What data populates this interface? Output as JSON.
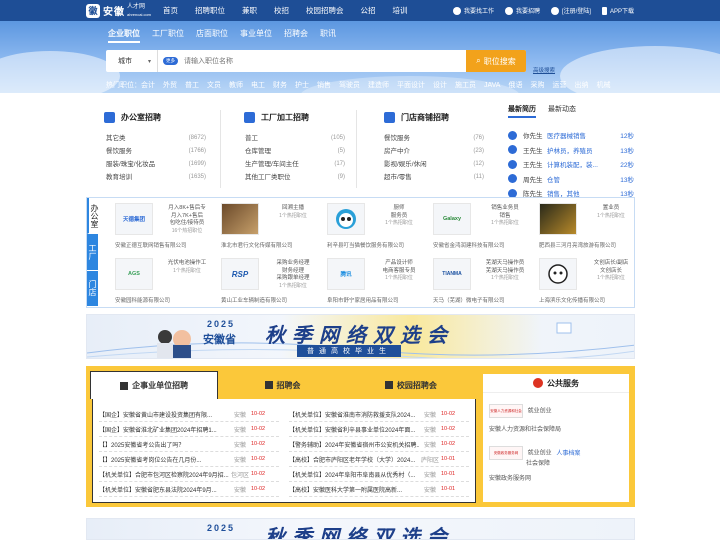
{
  "header": {
    "logo_cn": "安徽",
    "logo_small": "人才网",
    "logo_sub": "ahrencai.com",
    "nav": [
      "首页",
      "招聘职位",
      "兼职",
      "校招",
      "校园招聘会",
      "公招",
      "培训"
    ],
    "right": [
      "我要找工作",
      "我要招聘",
      "[注册/登陆]",
      "APP下载"
    ]
  },
  "search": {
    "tabs": [
      "企业职位",
      "工厂职位",
      "店面职位",
      "事业单位",
      "招聘会",
      "职讯"
    ],
    "city": "城市",
    "more_badge": "更多",
    "placeholder": "请输入职位名称",
    "button": "职位搜索",
    "advanced": "高级搜索",
    "hot_label": "热门职位：",
    "hot": [
      "会计",
      "外贸",
      "普工",
      "文员",
      "教师",
      "电工",
      "财务",
      "护士",
      "销售",
      "驾驶员",
      "建造师",
      "平面设计",
      "设计",
      "施工员",
      "JAVA",
      "俄语",
      "采购",
      "运营",
      "出纳",
      "机械"
    ]
  },
  "categories": [
    {
      "title": "办公室招聘",
      "items": [
        {
          "name": "其它类",
          "count": "(8672)"
        },
        {
          "name": "餐饮服务",
          "count": "(1766)"
        },
        {
          "name": "服装/珠宝/化妆品",
          "count": "(1699)"
        },
        {
          "name": "教育培训",
          "count": "(1635)"
        }
      ]
    },
    {
      "title": "工厂加工招聘",
      "items": [
        {
          "name": "普工",
          "count": "(105)"
        },
        {
          "name": "仓库管理",
          "count": "(5)"
        },
        {
          "name": "生产管理/车间主任",
          "count": "(17)"
        },
        {
          "name": "其他工厂类职位",
          "count": "(9)"
        }
      ]
    },
    {
      "title": "门店商铺招聘",
      "items": [
        {
          "name": "餐饮服务",
          "count": "(76)"
        },
        {
          "name": "房产中介",
          "count": "(23)"
        },
        {
          "name": "影视/娱乐/休闲",
          "count": "(12)"
        },
        {
          "name": "超市/零售",
          "count": "(11)"
        }
      ]
    }
  ],
  "latest": {
    "tabs": [
      "最新简历",
      "最新动态"
    ],
    "rows": [
      {
        "name": "你先生",
        "job": "医疗器械销售",
        "time": "12秒"
      },
      {
        "name": "王先生",
        "job": "护林员，养殖员",
        "time": "13秒"
      },
      {
        "name": "王先生",
        "job": "计算机装配，装...",
        "time": "22秒"
      },
      {
        "name": "周先生",
        "job": "仓管",
        "time": "13秒"
      },
      {
        "name": "陈先生",
        "job": "销售，其他",
        "time": "13秒"
      }
    ]
  },
  "companies": {
    "side_tabs": [
      "办公室",
      "工厂",
      "门店"
    ],
    "cards": [
      {
        "logo": "天德集团",
        "jobs": [
          "月入8K+售后专",
          "月入7K+售后",
          "包吃住/接待员"
        ],
        "more": "16个热招职位",
        "company": "安徽正德互联网销售有限公司"
      },
      {
        "logo": "",
        "jobs": [
          "回溯主播"
        ],
        "more": "1个热招职位",
        "company": "淮北市君行文化传媒有限公司"
      },
      {
        "logo": "",
        "jobs": [
          "厨师",
          "服务员"
        ],
        "more": "1个热招职位",
        "company": "利辛县叮当猫餐饮服务有限公司"
      },
      {
        "logo": "Galaxy",
        "jobs": [
          "销售业务员",
          "销售"
        ],
        "more": "1个热招职位",
        "company": "安徽省金鸿润建科技有限公司"
      },
      {
        "logo": "",
        "jobs": [
          "置业员"
        ],
        "more": "1个热招职位",
        "company": "肥西县三河月亮湾旅游有限公司"
      },
      {
        "logo": "AGS",
        "jobs": [
          "光伏电池操作工"
        ],
        "more": "1个热招职位",
        "company": "安徽园科能源有限公司"
      },
      {
        "logo": "RSP",
        "jobs": [
          "采购业务经理",
          "财务经理",
          "采购跟单经理"
        ],
        "more": "1个热招职位",
        "company": "黄山工业车辆制造有限公司"
      },
      {
        "logo": "腾讯",
        "jobs": [
          "产品设计师",
          "电商客服专员"
        ],
        "more": "1个热招职位",
        "company": "阜阳市舒宁家居用品有限公司"
      },
      {
        "logo": "TIANMA",
        "jobs": [
          "芜湖天马操作员",
          "芜湖天马操作员"
        ],
        "more": "1个热招职位",
        "company": "天马（芜湖）微电子有限公司"
      },
      {
        "logo": "",
        "jobs": [
          "文创店长/副店",
          "文创店长"
        ],
        "more": "1个热招职位",
        "company": "上海滨乐文化传播有限公司"
      }
    ]
  },
  "banner": {
    "year": "2025",
    "province": "安徽省",
    "title": "秋季网络双选会",
    "subtitle": "普通高校毕业生"
  },
  "joblist": {
    "tabs": [
      "企事业单位招聘",
      "招聘会",
      "校园招聘会"
    ],
    "left": [
      {
        "title": "【国企】安徽省黄山市建设投资集团有限...",
        "city": "安徽",
        "date": "10-02"
      },
      {
        "title": "【国企】安徽省淮北矿业集团2024年招聘1...",
        "city": "安徽",
        "date": "10-02"
      },
      {
        "title": "【】2025安徽省考公告出了吗？",
        "city": "安徽",
        "date": "10-02"
      },
      {
        "title": "【】2025安徽省考岗位公告在几月份...",
        "city": "安徽",
        "date": "10-02"
      },
      {
        "title": "【机关单位】合肥市包河区检察院2024年9月招...",
        "city": "包河区",
        "date": "10-02"
      },
      {
        "title": "【机关单位】安徽省肥东县法院2024年9月...",
        "city": "安徽",
        "date": "10-02"
      }
    ],
    "right": [
      {
        "title": "【机关单位】安徽省淮南市消防救援支队2024...",
        "city": "安徽",
        "date": "10-02"
      },
      {
        "title": "【机关单位】安徽省利辛县事业单位2024年面...",
        "city": "安徽",
        "date": "10-02"
      },
      {
        "title": "【警务辅助】2024年安徽省宿州市公安机关招聘...",
        "city": "安徽",
        "date": "10-02"
      },
      {
        "title": "【高校】合肥市庐阳区老年学校（大学）2024...",
        "city": "庐阳区",
        "date": "10-01"
      },
      {
        "title": "【机关单位】2024年阜阳市阜南县从优秀村（...",
        "city": "安徽",
        "date": "10-01"
      },
      {
        "title": "【高校】安徽医科大学第一附属医院高新...",
        "city": "安徽",
        "date": "10-01"
      }
    ]
  },
  "public": {
    "title": "公共服务",
    "items": [
      {
        "img": "安徽人力资源和社会保障厅",
        "side": "就业创业",
        "name": "安徽人力资源和社会保障局"
      },
      {
        "img": "安徽政务服务网",
        "side": "就业创业",
        "link": "人事档案",
        "extra": "社会保障",
        "name": "安徽政务服务网"
      }
    ]
  },
  "colors": {
    "primary": "#1e4e96",
    "accent": "#f2a21b",
    "tab_section": "#fbc83a",
    "link": "#2d6bd6",
    "date": "#d22222"
  }
}
